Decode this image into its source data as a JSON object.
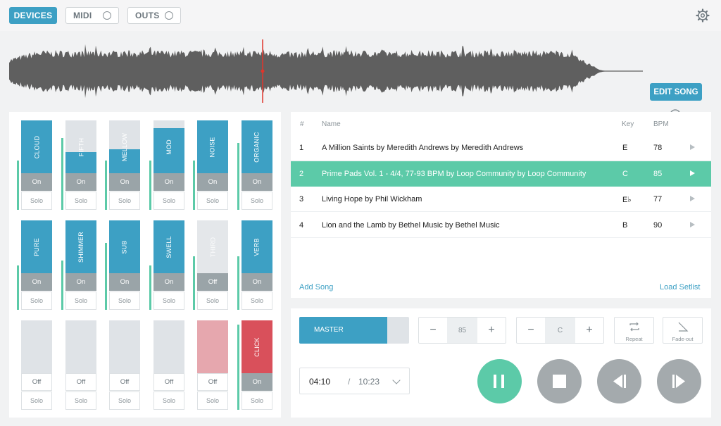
{
  "topbar": {
    "devices_label": "DEVICES",
    "midi_label": "MIDI",
    "outs_label": "OUTS"
  },
  "waveform": {
    "playhead_fraction": 0.4,
    "edit_song_label": "EDIT SONG",
    "colors": {
      "wave": "#5f5f5f",
      "playhead": "#e0352b"
    }
  },
  "mixer": {
    "channels": [
      {
        "name": "CLOUD",
        "state": "On",
        "solo": "Solo",
        "level": 1.0,
        "meter": 0.55
      },
      {
        "name": "FIFTH",
        "state": "On",
        "solo": "Solo",
        "level": 0.4,
        "meter": 0.8
      },
      {
        "name": "MELLOW",
        "state": "On",
        "solo": "Solo",
        "level": 0.45,
        "meter": 0.55
      },
      {
        "name": "MOD",
        "state": "On",
        "solo": "Solo",
        "level": 0.85,
        "meter": 0.55
      },
      {
        "name": "NOISE",
        "state": "On",
        "solo": "Solo",
        "level": 1.0,
        "meter": 0.55
      },
      {
        "name": "ORGANIC",
        "state": "On",
        "solo": "Solo",
        "level": 1.0,
        "meter": 0.75
      },
      {
        "name": "PURE",
        "state": "On",
        "solo": "Solo",
        "level": 1.0,
        "meter": 0.5
      },
      {
        "name": "SHIMMER",
        "state": "On",
        "solo": "Solo",
        "level": 1.0,
        "meter": 0.55
      },
      {
        "name": "SUB",
        "state": "On",
        "solo": "Solo",
        "level": 1.0,
        "meter": 0.75
      },
      {
        "name": "SWELL",
        "state": "On",
        "solo": "Solo",
        "level": 1.0,
        "meter": 0.5
      },
      {
        "name": "THIRD",
        "state": "Off",
        "solo": "Solo",
        "level": 1.0,
        "meter": 0.6,
        "dim": true
      },
      {
        "name": "VERB",
        "state": "On",
        "solo": "Solo",
        "level": 1.0,
        "meter": 0.6
      },
      {
        "name": "",
        "state": "Off",
        "solo": "Solo",
        "level": 0,
        "meter": 0
      },
      {
        "name": "",
        "state": "Off",
        "solo": "Solo",
        "level": 0,
        "meter": 0
      },
      {
        "name": "",
        "state": "Off",
        "solo": "Solo",
        "level": 0,
        "meter": 0
      },
      {
        "name": "",
        "state": "Off",
        "solo": "Solo",
        "level": 0,
        "meter": 0
      },
      {
        "name": "",
        "state": "Off",
        "solo": "Solo",
        "level": 1.0,
        "meter": 0,
        "color": "#e6a7ae"
      },
      {
        "name": "CLICK",
        "state": "On",
        "solo": "Solo",
        "level": 1.0,
        "meter": 0.95,
        "color": "#d9505b"
      }
    ]
  },
  "songlist": {
    "headers": {
      "num": "#",
      "name": "Name",
      "key": "Key",
      "bpm": "BPM"
    },
    "rows": [
      {
        "num": "1",
        "name": "A Million Saints by Meredith Andrews by Meredith Andrews",
        "key": "E",
        "bpm": "78"
      },
      {
        "num": "2",
        "name": "Prime Pads Vol. 1 - 4/4, 77-93 BPM by Loop Community by Loop Community",
        "key": "C",
        "bpm": "85",
        "active": true
      },
      {
        "num": "3",
        "name": "Living Hope by Phil Wickham",
        "key": "E♭",
        "bpm": "77"
      },
      {
        "num": "4",
        "name": "Lion and the Lamb by Bethel Music by Bethel Music",
        "key": "B",
        "bpm": "90"
      }
    ],
    "add_song_label": "Add Song",
    "load_setlist_label": "Load Setlist"
  },
  "transport": {
    "master_label": "MASTER",
    "master_level": 0.8,
    "tempo_value": "85",
    "key_value": "C",
    "minus": "−",
    "plus": "+",
    "repeat_label": "Repeat",
    "fadeout_label": "Fade-out",
    "elapsed": "04:10",
    "separator": "/",
    "total": "10:23"
  },
  "colors": {
    "accent": "#3da0c4",
    "active_row": "#5ccaa8",
    "click": "#d9505b"
  }
}
